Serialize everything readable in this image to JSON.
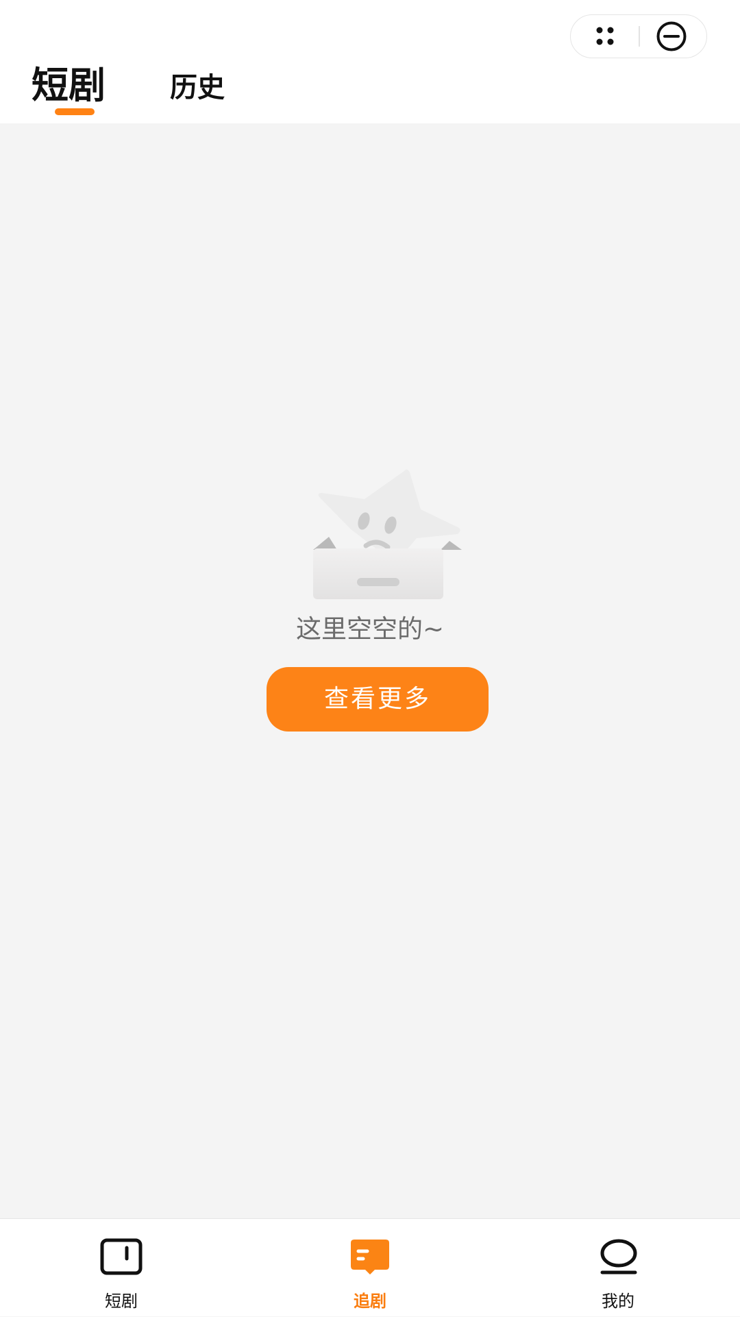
{
  "header": {
    "tabs": [
      {
        "label": "短剧",
        "active": true
      },
      {
        "label": "历史",
        "active": false
      }
    ],
    "capsule": {
      "more_icon": "more-dots-icon",
      "close_icon": "minus-circle-icon"
    }
  },
  "empty_state": {
    "illustration": "empty-box-star",
    "message": "这里空空的~",
    "button_label": "查看更多"
  },
  "tabbar": {
    "items": [
      {
        "label": "短剧",
        "icon": "tv-screen-icon",
        "active": false
      },
      {
        "label": "追剧",
        "icon": "book-icon",
        "active": true
      },
      {
        "label": "我的",
        "icon": "profile-icon",
        "active": false
      }
    ]
  },
  "colors": {
    "accent": "#fd8317",
    "background": "#f4f4f4",
    "text_primary": "#111111",
    "text_secondary": "#6b6b6b"
  }
}
